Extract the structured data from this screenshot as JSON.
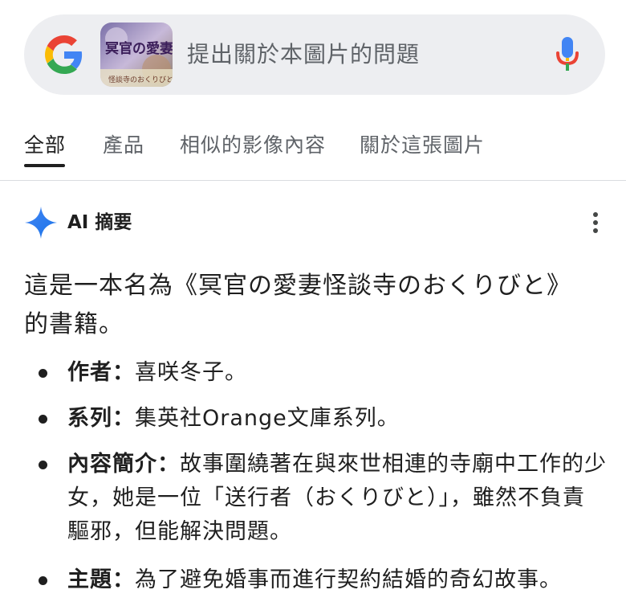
{
  "search": {
    "placeholder": "提出關於本圖片的問題",
    "thumbnail_title": "冥官の愛妻",
    "thumbnail_subtitle": "怪談寺のおくりびと"
  },
  "tabs": [
    {
      "label": "全部",
      "active": true
    },
    {
      "label": "產品",
      "active": false
    },
    {
      "label": "相似的影像內容",
      "active": false
    },
    {
      "label": "關於這張圖片",
      "active": false
    }
  ],
  "ai_overview": {
    "title": "AI 摘要",
    "summary_line1": "這是一本名為《冥官の愛妻怪談寺のおくりびと》",
    "summary_line2": "的書籍。",
    "bullets": [
      {
        "label": "作者：",
        "text": "喜咲冬子。"
      },
      {
        "label": "系列：",
        "text": "集英社Orange文庫系列。"
      },
      {
        "label": "內容簡介：",
        "text": "故事圍繞著在與來世相連的寺廟中工作的少女，她是一位「送行者（おくりびと）」，雖然不負責驅邪，但能解決問題。"
      },
      {
        "label": "主題：",
        "text": "為了避免婚事而進行契約結婚的奇幻故事。"
      }
    ]
  },
  "colors": {
    "search_bg": "#edeef1",
    "accent_blue": "#4285f4",
    "text_primary": "#1f1f1f",
    "text_secondary": "#5f6368"
  }
}
